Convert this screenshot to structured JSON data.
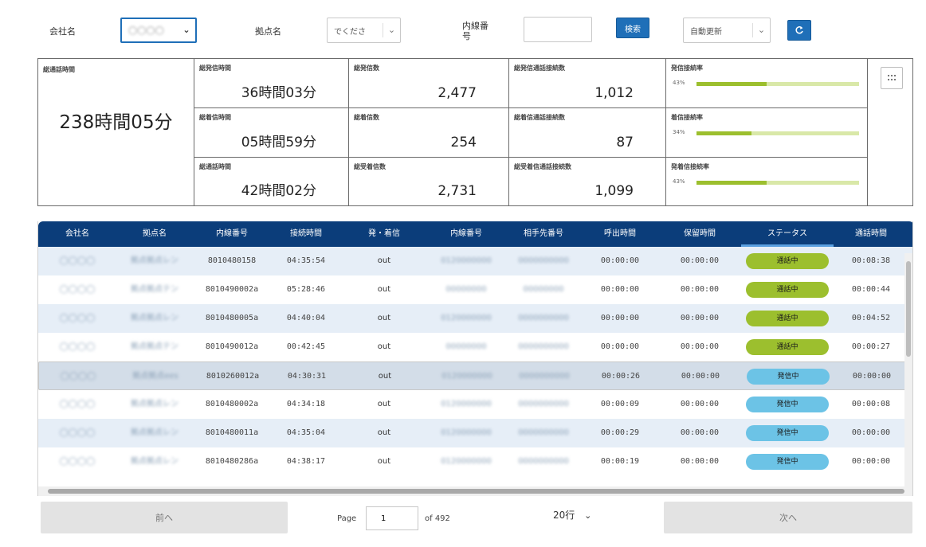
{
  "filters": {
    "company_label": "会社名",
    "company_value": "◯◯◯◯",
    "site_label": "拠点名",
    "site_value": "でくださ",
    "ext_label": "内線番号",
    "ext_value": "",
    "search_label": "検索",
    "auto_value": "自動更新",
    "refresh_icon": "refresh-icon",
    "chevron": "⌄"
  },
  "stats": {
    "total_call_time": {
      "label": "総通話時間",
      "value": "238時間05分"
    },
    "outgoing_time": {
      "label": "総発信時間",
      "value": "36時間03分"
    },
    "incoming_time": {
      "label": "総着信時間",
      "value": "05時間59分"
    },
    "ext_time": {
      "label": "総通話時間",
      "value": "42時間02分"
    },
    "outgoing_count": {
      "label": "総発信数",
      "value": "2,477"
    },
    "incoming_count": {
      "label": "総着信数",
      "value": "254"
    },
    "received_count": {
      "label": "総受着信数",
      "value": "2,731"
    },
    "outgoing_connected": {
      "label": "総発信通話接続数",
      "value": "1,012"
    },
    "incoming_connected": {
      "label": "総着信通話接続数",
      "value": "87"
    },
    "received_connected": {
      "label": "総受着信通話接続数",
      "value": "1,099"
    },
    "outgoing_rate": {
      "label": "発信接続率",
      "pct_text": "43%",
      "pct": 0.43
    },
    "incoming_rate": {
      "label": "着信接続率",
      "pct_text": "34%",
      "pct": 0.34
    },
    "received_rate": {
      "label": "発着信接続率",
      "pct_text": "43%",
      "pct": 0.43
    }
  },
  "table": {
    "headers": [
      "会社名",
      "拠点名",
      "内線番号",
      "接続時間",
      "発・着信",
      "内線番号",
      "相手先番号",
      "呼出時間",
      "保留時間",
      "ステータス",
      "通話時間"
    ],
    "rows": [
      {
        "company": "◯◯◯◯",
        "site": "拠点拠点レン",
        "ext": "8010480158",
        "connect": "04:35:54",
        "dir": "out",
        "ext2": "0120000000",
        "dest": "0000000000",
        "ring": "00:00:00",
        "hold": "00:00:00",
        "status": "通話中",
        "talk": "00:08:38"
      },
      {
        "company": "◯◯◯◯",
        "site": "拠点拠点テン",
        "ext": "8010490002a",
        "connect": "05:28:46",
        "dir": "out",
        "ext2": "00000000",
        "dest": "00000000",
        "ring": "00:00:00",
        "hold": "00:00:00",
        "status": "通話中",
        "talk": "00:00:44"
      },
      {
        "company": "◯◯◯◯",
        "site": "拠点拠点レン",
        "ext": "8010480005a",
        "connect": "04:40:04",
        "dir": "out",
        "ext2": "0120000000",
        "dest": "0000000000",
        "ring": "00:00:00",
        "hold": "00:00:00",
        "status": "通話中",
        "talk": "00:04:52"
      },
      {
        "company": "◯◯◯◯",
        "site": "拠点拠点テン",
        "ext": "8010490012a",
        "connect": "00:42:45",
        "dir": "out",
        "ext2": "00000000",
        "dest": "0000000000",
        "ring": "00:00:00",
        "hold": "00:00:00",
        "status": "通話中",
        "talk": "00:00:27"
      },
      {
        "company": "◯◯◯◯",
        "site": "拠点拠点ees",
        "ext": "8010260012a",
        "connect": "04:30:31",
        "dir": "out",
        "ext2": "0120000000",
        "dest": "0000000000",
        "ring": "00:00:26",
        "hold": "00:00:00",
        "status": "発信中",
        "talk": "00:00:00"
      },
      {
        "company": "◯◯◯◯",
        "site": "拠点拠点レン",
        "ext": "8010480002a",
        "connect": "04:34:18",
        "dir": "out",
        "ext2": "0120000000",
        "dest": "0000000000",
        "ring": "00:00:09",
        "hold": "00:00:00",
        "status": "発信中",
        "talk": "00:00:08"
      },
      {
        "company": "◯◯◯◯",
        "site": "拠点拠点レン",
        "ext": "8010480011a",
        "connect": "04:35:04",
        "dir": "out",
        "ext2": "0120000000",
        "dest": "0000000000",
        "ring": "00:00:29",
        "hold": "00:00:00",
        "status": "発信中",
        "talk": "00:00:00"
      },
      {
        "company": "◯◯◯◯",
        "site": "拠点拠点レン",
        "ext": "8010480286a",
        "connect": "04:38:17",
        "dir": "out",
        "ext2": "0120000000",
        "dest": "0000000000",
        "ring": "00:00:19",
        "hold": "00:00:00",
        "status": "発信中",
        "talk": "00:00:00"
      }
    ]
  },
  "pager": {
    "prev_label": "前へ",
    "page_label": "Page",
    "page_value": "1",
    "of_label": "of 492",
    "rows_label": "20行",
    "chevron": "⌄",
    "next_label": "次へ"
  },
  "colors": {
    "header_bg": "#0b3d7a",
    "accent": "#1f6fb8",
    "talking": "#9cbf2e",
    "ringing": "#6cc3e6"
  }
}
